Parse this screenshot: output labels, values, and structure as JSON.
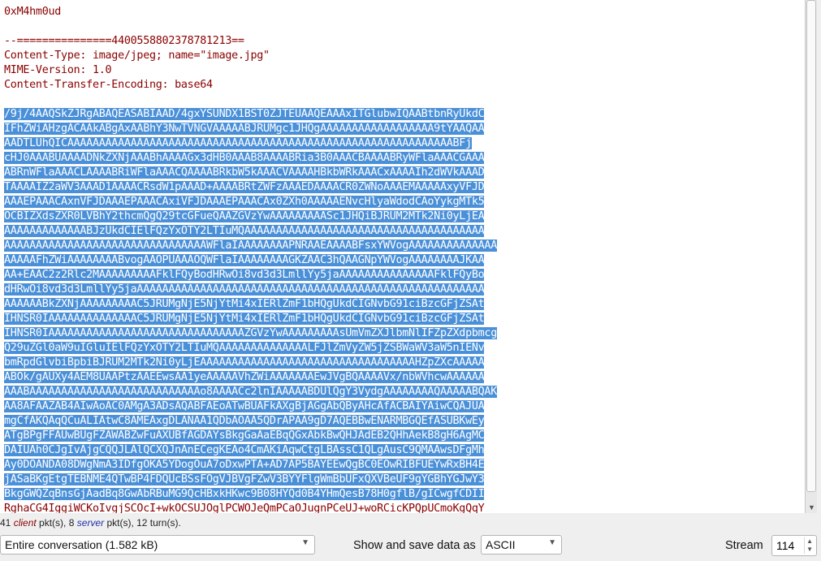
{
  "stream": {
    "header_lines": [
      "0xM4hm0ud",
      "",
      "--===============4400558802378781213==",
      "Content-Type: image/jpeg; name=\"image.jpg\"",
      "MIME-Version: 1.0",
      "Content-Transfer-Encoding: base64",
      ""
    ],
    "selected_lines": [
      "/9j/4AAQSkZJRgABAQEASABIAAD/4gxYSUNDX1BST0ZJTEUAAQEAAAxITGlubwIQAABtbnRyUkdC",
      "IFhZWiAHzgACAAkABgAxAABhY3NwTVNGVAAAAABJRUMgc1JHQgAAAAAAAAAAAAAAAAAA9tYAAQAA",
      "AADTLUhQICAAAAAAAAAAAAAAAAAAAAAAAAAAAAAAAAAAAAAAAAAAAAAAAAAAAAAAAAAAAAABFj",
      "cHJ0AAABUAAAADNkZXNjAAABhAAAAGx3dHB0AAAB8AAAABRia3B0AAACBAAAABRyWFlaAAACGAAA",
      "ABRnWFlaAAACLAAAABRiWFlaAAACQAAAABRkbW5kAAACVAAAAHBkbWRkAAACxAAAAIh2dWVkAAAD",
      "TAAAAIZ2aWV3AAAD1AAAACRsdW1pAAAD+AAAABRtZWFzAAAEDAAAACR0ZWNoAAAEMAAAAAxyVFJD",
      "AAAEPAAACAxnVFJDAAAEPAAACAxiVFJDAAAEPAAACAx0ZXh0AAAAAENvcHlyaWdodCAoYykgMTk5",
      "OCBIZXdsZXR0LVBhY2thcmQgQ29tcGFueQAAZGVzYwAAAAAAAAASc1JHQiBJRUM2MTk2Ni0yLjEA",
      "AAAAAAAAAAAAABJzUkdCIElFQzYxOTY2LTIuMQAAAAAAAAAAAAAAAAAAAAAAAAAAAAAAAAAAAAAA",
      "AAAAAAAAAAAAAAAAAAAAAAAAAAAAAAAAWFlaIAAAAAAAAPNRAAEAAAABFsxYWVogAAAAAAAAAAAAAA",
      "AAAAAFhZWiAAAAAAAABvogAAOPUAAAOQWFlaIAAAAAAAAGKZAAC3hQAAGNpYWVogAAAAAAAAJKAA",
      "AA+EAAC2z2Rlc2MAAAAAAAAAFklFQyBodHRwOi8vd3d3LmllYy5jaAAAAAAAAAAAAAAAFklFQyBo",
      "dHRwOi8vd3d3LmllYy5jaAAAAAAAAAAAAAAAAAAAAAAAAAAAAAAAAAAAAAAAAAAAAAAAAAAAAAAA",
      "AAAAAABkZXNjAAAAAAAAAC5JRUMgNjE5NjYtMi4xIERlZmF1bHQgUkdCIGNvbG91ciBzcGFjZSAt",
      "IHNSR0IAAAAAAAAAAAAAAC5JRUMgNjE5NjYtMi4xIERlZmF1bHQgUkdCIGNvbG91ciBzcGFjZSAt",
      "IHNSR0IAAAAAAAAAAAAAAAAAAAAAAAAAAAAAAAZGVzYwAAAAAAAAAsUmVmZXJlbmNlIFZpZXdpbmcg",
      "Q29uZGl0aW9uIGluIElFQzYxOTY2LTIuMQAAAAAAAAAAAAAALFJlZmVyZW5jZSBWaWV3aW5nIENv",
      "bmRpdGlvbiBpbiBJRUM2MTk2Ni0yLjEAAAAAAAAAAAAAAAAAAAAAAAAAAAAAAAAAAHZpZXcAAAAA",
      "ABOk/gAUXy4AEM8UAAPtzAAEEwsAA1yeAAAAAVhZWiAAAAAAAEwJVgBQAAAAVx/nbWVhcwAAAAAA",
      "AAABAAAAAAAAAAAAAAAAAAAAAAAAAAAo8AAAACc2lnIAAAAABDUlQgY3VydgAAAAAAAAQAAAAABQAK",
      "AA8AFAAZAB4AIwAoAC0AMgA3ADsAQABFAEoATwBUAFkAXgBjAGgAbQByAHcAfACBAIYAiwCQAJUA",
      "mgCfAKQAqQCuALIAtwC8AMEAxgDLANAA1QDbAOAA5QDrAPAA9gD7AQEBBwENARMBGQEfASUBKwEy",
      "ATgBPgFFAUwBUgFZAWABZwFuAXUBfAGDAYsBkgGaAaEBqQGxAbkBwQHJAdEB2QHhAekB8gH6AgMC",
      "DAIUAh0CJgIvAjgCQQJLAlQCXQJnAnECegKEAo4CmAKiAqwCtgLBAssC1QLgAusC9QMAAwsDFgMh",
      "Ay0DOANDA08DWgNmA3IDfgOKA5YDogOuA7oDxwPTA+AD7AP5BAYEEwQgBC0EOwRIBFUEYwRxBH4E",
      "jASaBKgEtgTEBNME4QTwBP4FDQUcBSsFOgVJBVgFZwV3BYYFlgWmBbUFxQXVBeUF9gYGBhYGJwY3",
      "BkgGWQZqBnsGjAadBq8GwAbRBuMG9QcHBxkHKwc9B08HYQd0B4YHmQesB78H0gflB/gICwgfCDII"
    ],
    "trailing_line": "RghaCG4IggiWCKoIvgjSCOcI+wkOCSUJOglPCWOJeQmPCaOJugnPCeUJ+woRCicKPQpUCmoKgQqY"
  },
  "summary": {
    "client_count": "41",
    "client_word": "client",
    "client_suffix": " pkt(s), ",
    "server_count": "8",
    "server_word": "server",
    "server_suffix": " pkt(s), 12 turn(s)."
  },
  "controls": {
    "conversation_value": "Entire conversation (1.582 kB)",
    "format_label": "Show and save data as",
    "format_value": "ASCII",
    "stream_label": "Stream",
    "stream_value": "114"
  },
  "colors": {
    "client_text": "#8b0000",
    "server_text": "#1c2ea8",
    "selection": "#4a90d9"
  },
  "icons": {
    "dropdown": "chevron-down-icon",
    "spin_up": "chevron-up-icon",
    "spin_down": "chevron-down-icon"
  }
}
